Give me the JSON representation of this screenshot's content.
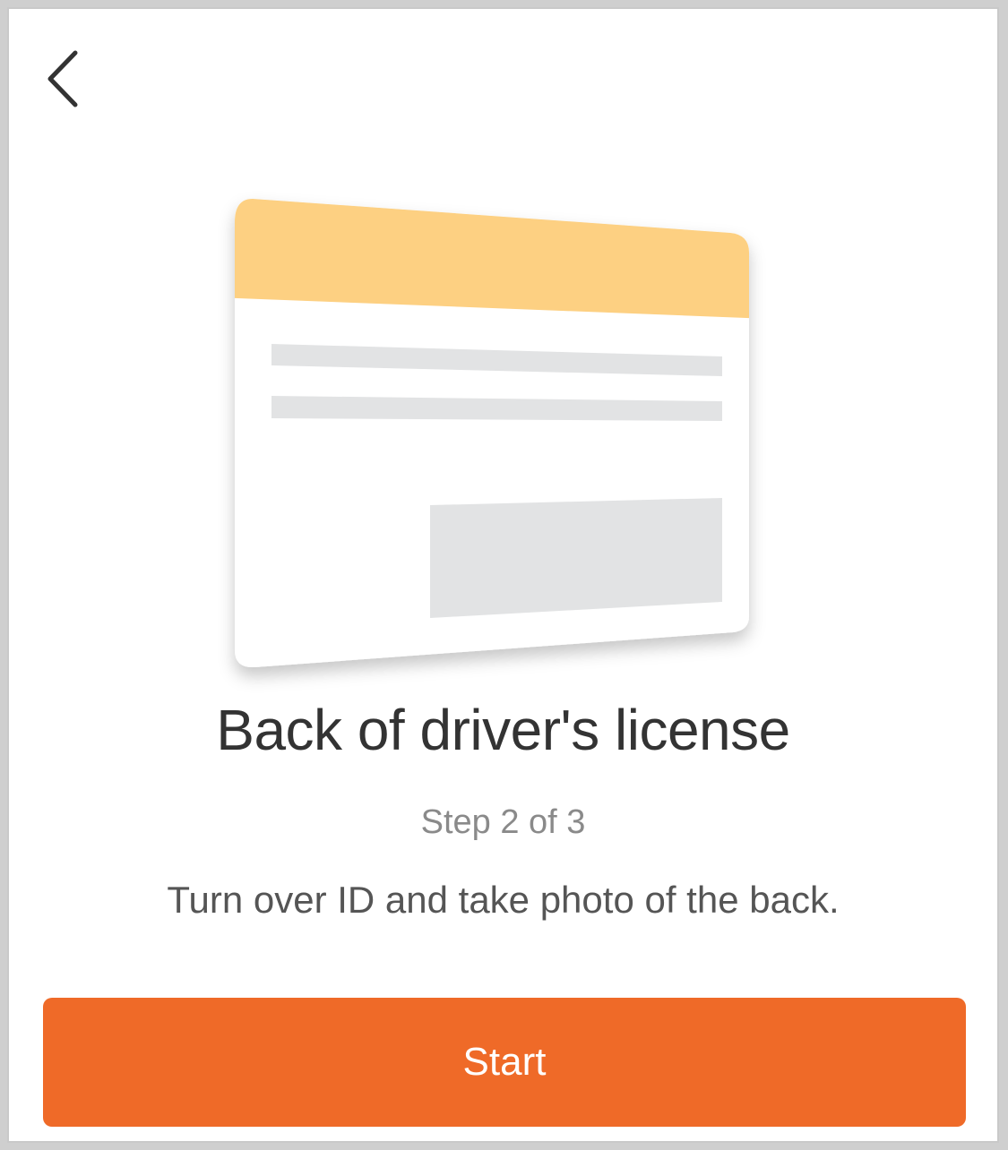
{
  "nav": {
    "back_icon": "chevron-left-icon"
  },
  "illustration": {
    "icon": "id-card-back-icon",
    "stripe_color": "#FDD082",
    "placeholder_color": "#E2E3E4"
  },
  "content": {
    "title": "Back of driver's license",
    "step": "Step 2 of 3",
    "description": "Turn over ID and take photo of the back."
  },
  "actions": {
    "start_label": "Start",
    "start_color": "#EF6A28"
  }
}
